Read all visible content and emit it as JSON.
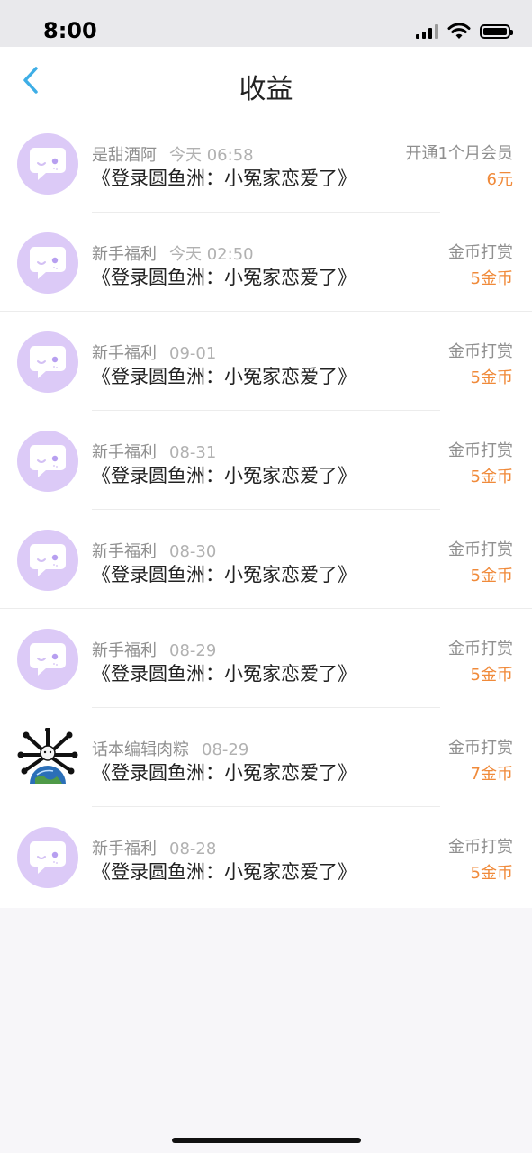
{
  "status_bar": {
    "time": "8:00"
  },
  "nav": {
    "title": "收益"
  },
  "colors": {
    "accent": "#3eaee6",
    "amount": "#f08a3a",
    "avatar_bg": "#dccaf7"
  },
  "earnings": [
    {
      "name": "是甜酒阿",
      "date": "今天 06:58",
      "title": "《登录圆鱼洲：小冤家恋爱了》",
      "type": "开通1个月会员",
      "amount": "6元",
      "avatar": "default-avatar-icon"
    },
    {
      "name": "新手福利",
      "date": "今天 02:50",
      "title": "《登录圆鱼洲：小冤家恋爱了》",
      "type": "金币打赏",
      "amount": "5金币",
      "avatar": "default-avatar-icon"
    },
    {
      "name": "新手福利",
      "date": "09-01",
      "title": "《登录圆鱼洲：小冤家恋爱了》",
      "type": "金币打赏",
      "amount": "5金币",
      "avatar": "default-avatar-icon"
    },
    {
      "name": "新手福利",
      "date": "08-31",
      "title": "《登录圆鱼洲：小冤家恋爱了》",
      "type": "金币打赏",
      "amount": "5金币",
      "avatar": "default-avatar-icon"
    },
    {
      "name": "新手福利",
      "date": "08-30",
      "title": "《登录圆鱼洲：小冤家恋爱了》",
      "type": "金币打赏",
      "amount": "5金币",
      "avatar": "default-avatar-icon"
    },
    {
      "name": "新手福利",
      "date": "08-29",
      "title": "《登录圆鱼洲：小冤家恋爱了》",
      "type": "金币打赏",
      "amount": "5金币",
      "avatar": "default-avatar-icon"
    },
    {
      "name": "话本编辑肉粽",
      "date": "08-29",
      "title": "《登录圆鱼洲：小冤家恋爱了》",
      "type": "金币打赏",
      "amount": "7金币",
      "avatar": "globe-avatar-icon"
    },
    {
      "name": "新手福利",
      "date": "08-28",
      "title": "《登录圆鱼洲：小冤家恋爱了》",
      "type": "金币打赏",
      "amount": "5金币",
      "avatar": "default-avatar-icon"
    }
  ]
}
